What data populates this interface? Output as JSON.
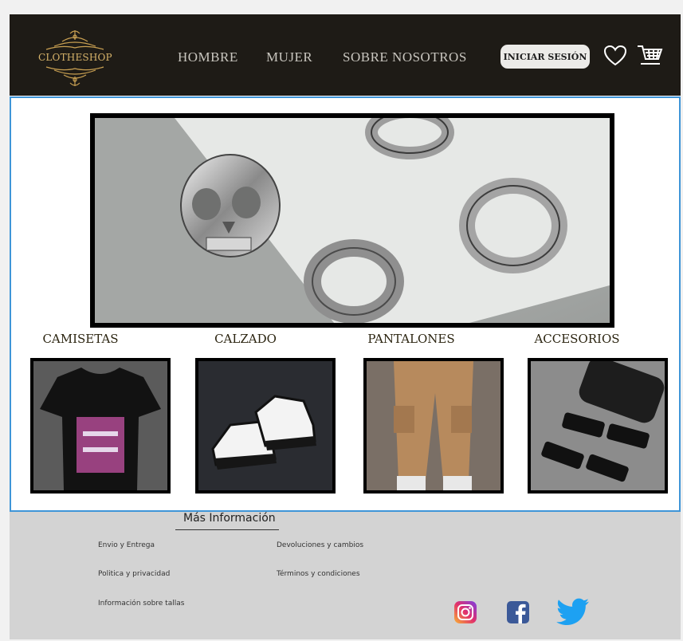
{
  "header": {
    "logo_text": "CLOTHESHOP",
    "nav": [
      "HOMBRE",
      "MUJER",
      "SOBRE NOSOTROS"
    ],
    "login_label": "INICIAR SESIÓN",
    "icons": [
      "heart-icon",
      "cart-icon"
    ]
  },
  "hero": {
    "image": "silver-rings-photo"
  },
  "categories": [
    {
      "title": "CAMISETAS",
      "image": "black-tshirt-photo"
    },
    {
      "title": "CALZADO",
      "image": "sneakers-photo"
    },
    {
      "title": "PANTALONES",
      "image": "cargo-pants-photo"
    },
    {
      "title": "ACCESORIOS",
      "image": "sunglasses-photo"
    }
  ],
  "footer": {
    "title": "Más Información",
    "links": {
      "envio": "Envio y Entrega",
      "politica": "Politica y privacidad",
      "tallas": "Información sobre tallas",
      "devoluciones": "Devoluciones y cambios",
      "terminos": "Términos y condiciones"
    },
    "social": [
      "instagram-icon",
      "facebook-icon",
      "twitter-icon"
    ]
  },
  "colors": {
    "header_bg": "#1e1b16",
    "accent_border": "#3f95d8",
    "footer_bg": "#d3d3d3",
    "logo_gold": "#d8b46a"
  }
}
